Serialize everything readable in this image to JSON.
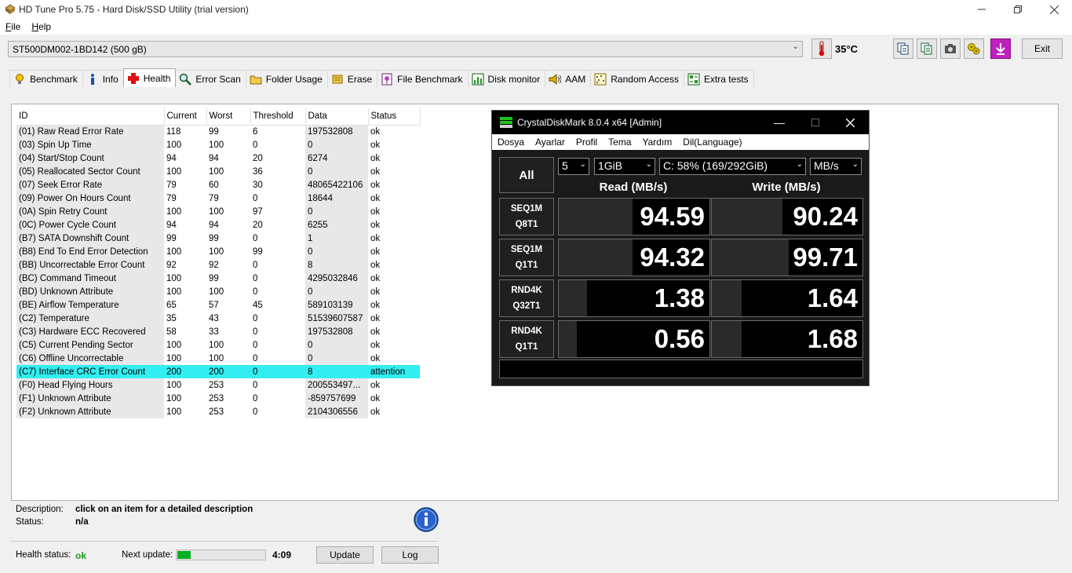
{
  "window": {
    "title": "HD Tune Pro 5.75 - Hard Disk/SSD Utility (trial version)"
  },
  "menu": {
    "items": [
      {
        "label": "File",
        "accel": "F",
        "rest": "ile"
      },
      {
        "label": "Help",
        "accel": "H",
        "rest": "elp"
      }
    ]
  },
  "toolbar": {
    "drive": "ST500DM002-1BD142 (500 gB)",
    "temperature": "35°C",
    "exit_label": "Exit"
  },
  "tabs": [
    {
      "label": "Benchmark",
      "icon": "lightbulb-icon"
    },
    {
      "label": "Info",
      "icon": "info-icon"
    },
    {
      "label": "Health",
      "icon": "health-cross-icon",
      "active": true
    },
    {
      "label": "Error Scan",
      "icon": "magnifier-icon"
    },
    {
      "label": "Folder Usage",
      "icon": "folder-icon"
    },
    {
      "label": "Erase",
      "icon": "erase-icon"
    },
    {
      "label": "File Benchmark",
      "icon": "file-benchmark-icon"
    },
    {
      "label": "Disk monitor",
      "icon": "disk-monitor-icon"
    },
    {
      "label": "AAM",
      "icon": "speaker-icon"
    },
    {
      "label": "Random Access",
      "icon": "random-access-icon"
    },
    {
      "label": "Extra tests",
      "icon": "extra-tests-icon"
    }
  ],
  "health_table": {
    "headers": [
      "ID",
      "Current",
      "Worst",
      "Threshold",
      "Data",
      "Status"
    ],
    "rows": [
      [
        "(01) Raw Read Error Rate",
        "118",
        "99",
        "6",
        "197532808",
        "ok"
      ],
      [
        "(03) Spin Up Time",
        "100",
        "100",
        "0",
        "0",
        "ok"
      ],
      [
        "(04) Start/Stop Count",
        "94",
        "94",
        "20",
        "6274",
        "ok"
      ],
      [
        "(05) Reallocated Sector Count",
        "100",
        "100",
        "36",
        "0",
        "ok"
      ],
      [
        "(07) Seek Error Rate",
        "79",
        "60",
        "30",
        "48065422106",
        "ok"
      ],
      [
        "(09) Power On Hours Count",
        "79",
        "79",
        "0",
        "18644",
        "ok"
      ],
      [
        "(0A) Spin Retry Count",
        "100",
        "100",
        "97",
        "0",
        "ok"
      ],
      [
        "(0C) Power Cycle Count",
        "94",
        "94",
        "20",
        "6255",
        "ok"
      ],
      [
        "(B7) SATA Downshift Count",
        "99",
        "99",
        "0",
        "1",
        "ok"
      ],
      [
        "(B8) End To End Error Detection",
        "100",
        "100",
        "99",
        "0",
        "ok"
      ],
      [
        "(BB) Uncorrectable Error Count",
        "92",
        "92",
        "0",
        "8",
        "ok"
      ],
      [
        "(BC) Command Timeout",
        "100",
        "99",
        "0",
        "4295032846",
        "ok"
      ],
      [
        "(BD) Unknown Attribute",
        "100",
        "100",
        "0",
        "0",
        "ok"
      ],
      [
        "(BE) Airflow Temperature",
        "65",
        "57",
        "45",
        "589103139",
        "ok"
      ],
      [
        "(C2) Temperature",
        "35",
        "43",
        "0",
        "51539607587",
        "ok"
      ],
      [
        "(C3) Hardware ECC Recovered",
        "58",
        "33",
        "0",
        "197532808",
        "ok"
      ],
      [
        "(C5) Current Pending Sector",
        "100",
        "100",
        "0",
        "0",
        "ok"
      ],
      [
        "(C6) Offline Uncorrectable",
        "100",
        "100",
        "0",
        "0",
        "ok"
      ],
      [
        "(C7) Interface CRC Error Count",
        "200",
        "200",
        "0",
        "8",
        "attention"
      ],
      [
        "(F0) Head Flying Hours",
        "100",
        "253",
        "0",
        "200553497...",
        "ok"
      ],
      [
        "(F1) Unknown Attribute",
        "100",
        "253",
        "0",
        "-859757699",
        "ok"
      ],
      [
        "(F2) Unknown Attribute",
        "100",
        "253",
        "0",
        "2104306556",
        "ok"
      ]
    ],
    "highlight_color": "#33eef0"
  },
  "cdm": {
    "title": "CrystalDiskMark 8.0.4 x64 [Admin]",
    "menu": [
      "Dosya",
      "Ayarlar",
      "Profil",
      "Tema",
      "Yardım",
      "Dil(Language)"
    ],
    "all_label": "All",
    "count": "5",
    "size": "1GiB",
    "drive": "C: 58% (169/292GiB)",
    "unit": "MB/s",
    "read_header": "Read (MB/s)",
    "write_header": "Write (MB/s)",
    "tests": [
      {
        "line1": "SEQ1M",
        "line2": "Q8T1",
        "read": "94.59",
        "write": "90.24",
        "read_fill": 0.49,
        "write_fill": 0.47
      },
      {
        "line1": "SEQ1M",
        "line2": "Q1T1",
        "read": "94.32",
        "write": "99.71",
        "read_fill": 0.49,
        "write_fill": 0.51
      },
      {
        "line1": "RND4K",
        "line2": "Q32T1",
        "read": "1.38",
        "write": "1.64",
        "read_fill": 0.19,
        "write_fill": 0.2
      },
      {
        "line1": "RND4K",
        "line2": "Q1T1",
        "read": "0.56",
        "write": "1.68",
        "read_fill": 0.12,
        "write_fill": 0.2
      }
    ]
  },
  "bottom": {
    "description_label": "Description:",
    "description_value": "click on an item for a detailed description",
    "status_label": "Status:",
    "status_value": "n/a",
    "health_status_label": "Health status:",
    "health_status_value": "ok",
    "next_update_label": "Next update:",
    "next_update_time": "4:09",
    "progress_fraction": 0.15,
    "update_label": "Update",
    "log_label": "Log"
  }
}
